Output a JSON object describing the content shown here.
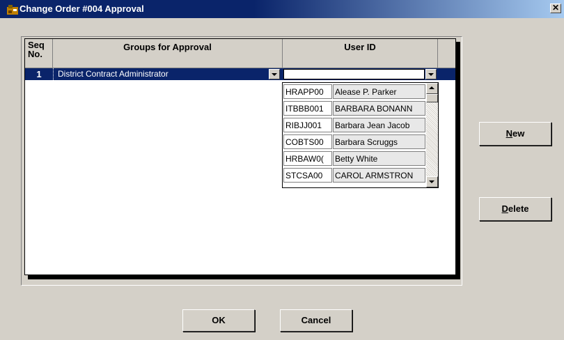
{
  "window": {
    "title": "Change Order #004 Approval",
    "close_glyph": "✕"
  },
  "grid": {
    "columns": {
      "seq": "Seq No.",
      "seq_line1": "Seq",
      "seq_line2": "No.",
      "group": "Groups for Approval",
      "user": "User ID"
    },
    "rows": [
      {
        "seq": "1",
        "group": "District Contract Administrator",
        "user": ""
      }
    ]
  },
  "dropdown": {
    "items": [
      {
        "id": "HRAPP00",
        "name": "Alease P. Parker"
      },
      {
        "id": "ITBBB001",
        "name": "BARBARA BONANN"
      },
      {
        "id": "RIBJJ001",
        "name": "Barbara Jean Jacob"
      },
      {
        "id": "COBTS00",
        "name": "Barbara Scruggs"
      },
      {
        "id": "HRBAW0(",
        "name": "Betty White"
      },
      {
        "id": "STCSA00",
        "name": "CAROL ARMSTRON"
      }
    ]
  },
  "buttons": {
    "new_label": "ew",
    "new_mnemonic": "N",
    "delete_label": "elete",
    "delete_mnemonic": "D",
    "ok_label": "OK",
    "cancel_label": "Cancel"
  },
  "icons": {
    "app": "app-icon",
    "close": "close-icon",
    "dropdown": "chevron-down-icon"
  },
  "colors": {
    "titlebar": "#0a246a",
    "selection": "#0a246a",
    "face": "#d4d0c8"
  }
}
